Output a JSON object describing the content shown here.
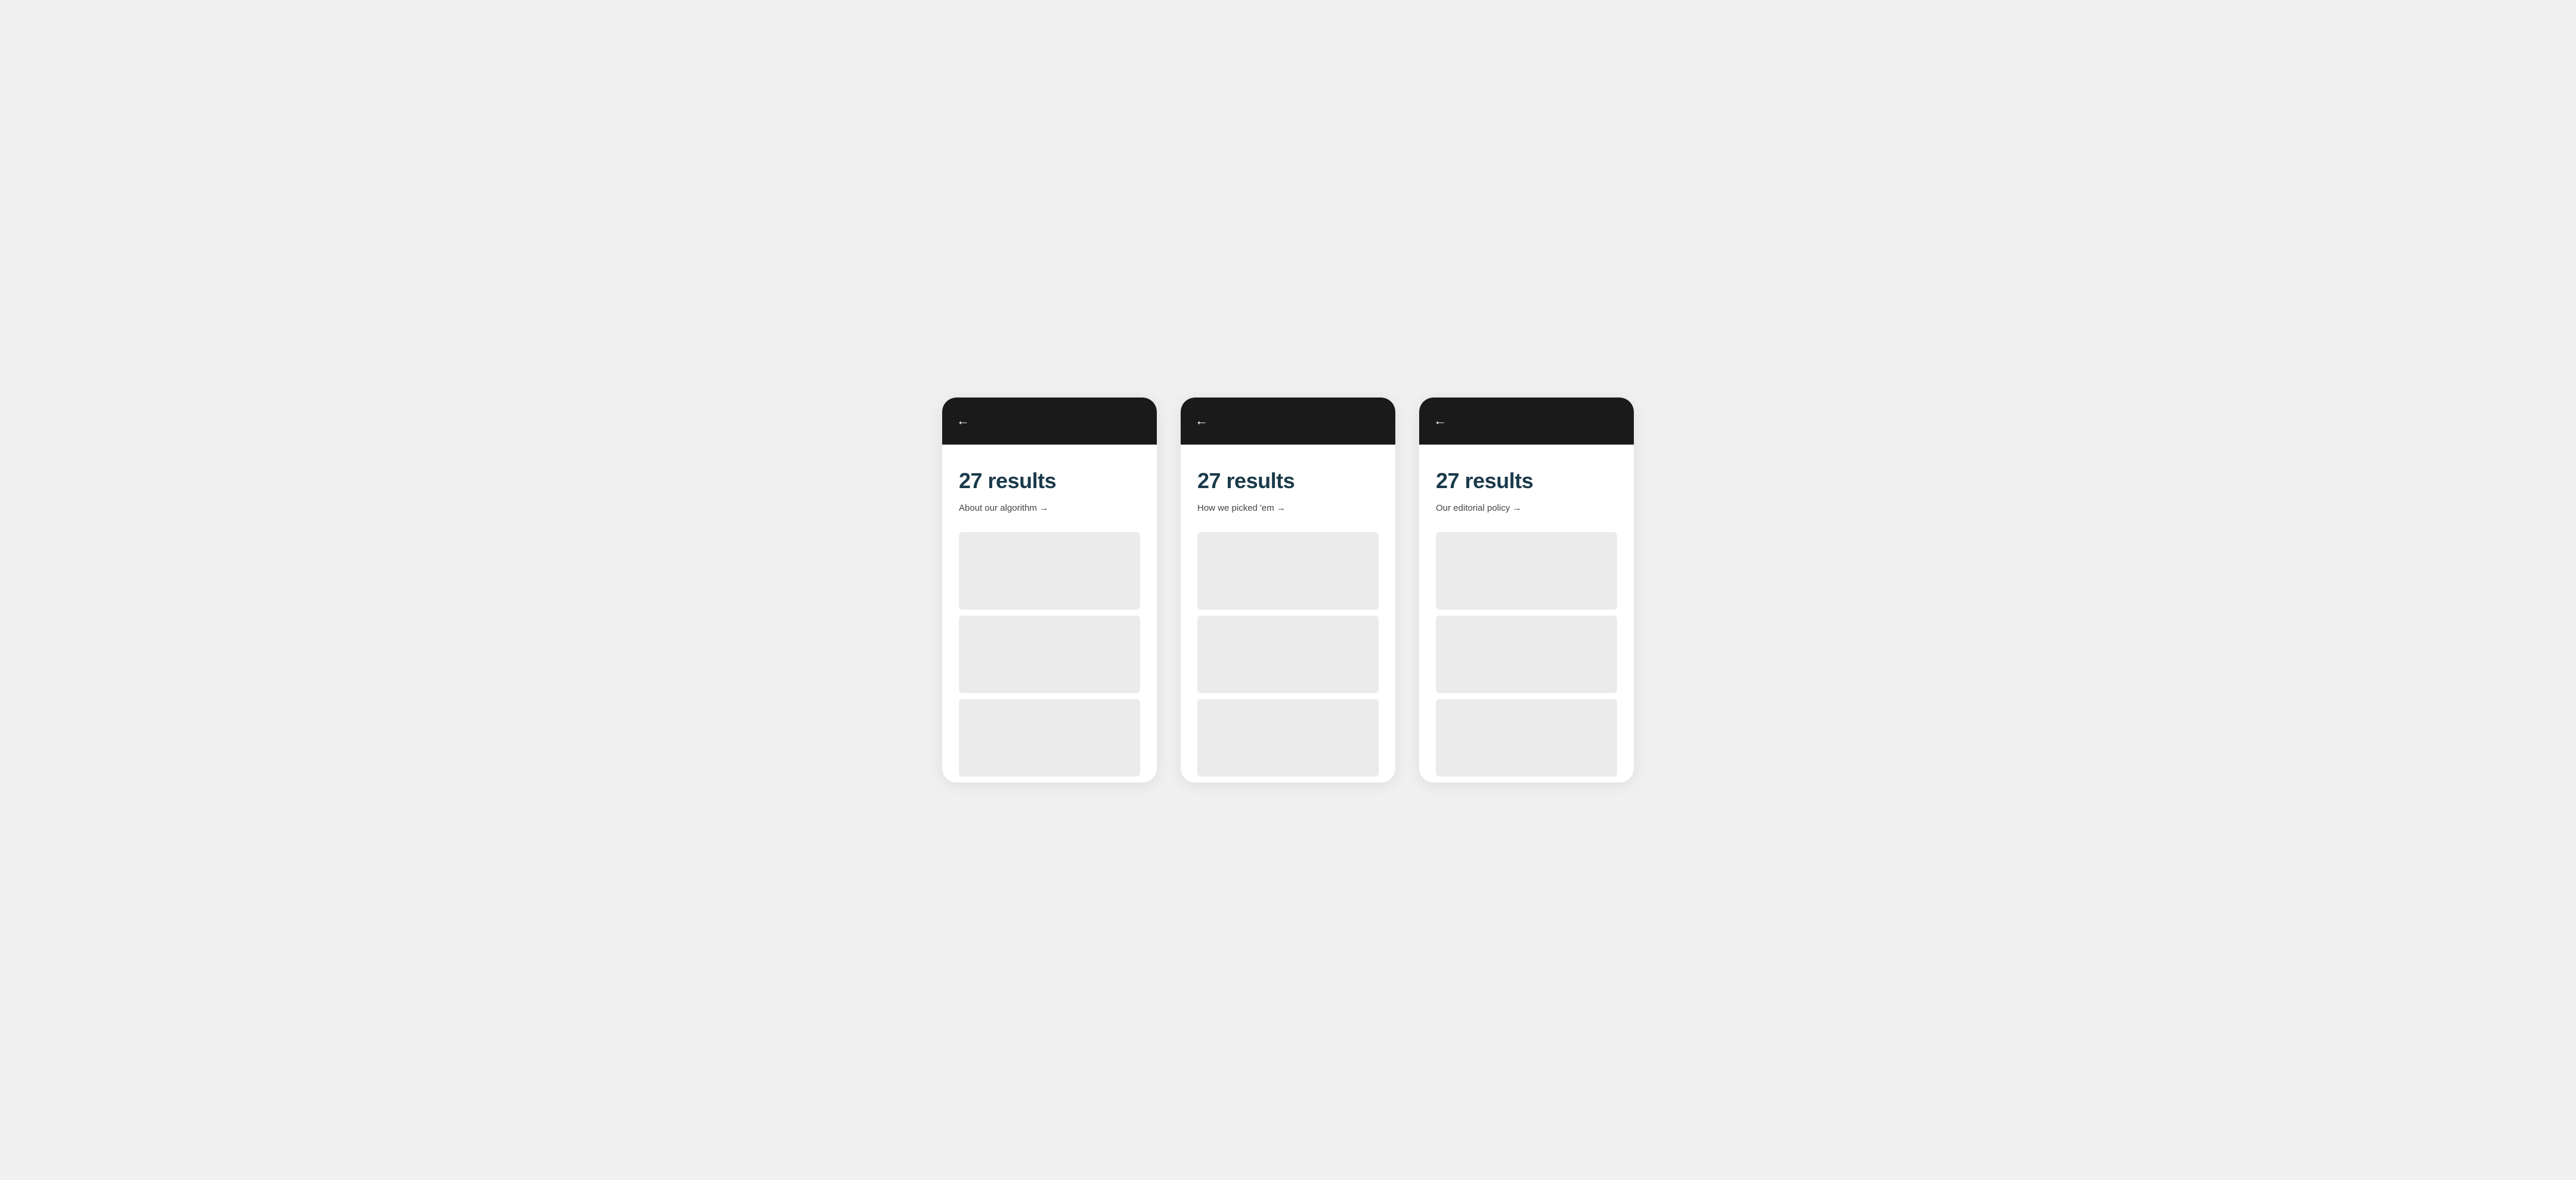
{
  "page": {
    "background_color": "#f0f0f0"
  },
  "phones": [
    {
      "id": "phone-1",
      "results_count": "27 results",
      "link_text": "About our algorithm →",
      "back_label": "←"
    },
    {
      "id": "phone-2",
      "results_count": "27 results",
      "link_text": "How we picked 'em →",
      "back_label": "←"
    },
    {
      "id": "phone-3",
      "results_count": "27 results",
      "link_text": "Our editorial policy →",
      "back_label": "←"
    }
  ]
}
